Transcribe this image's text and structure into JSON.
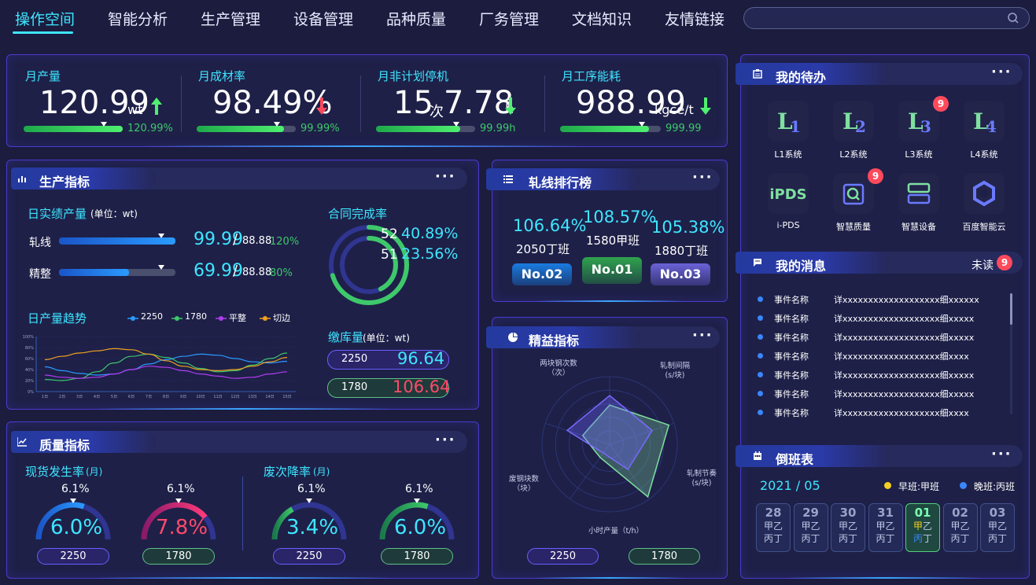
{
  "nav": {
    "items": [
      "操作空间",
      "智能分析",
      "生产管理",
      "设备管理",
      "品种质量",
      "厂务管理",
      "文档知识",
      "友情链接"
    ],
    "active_index": 0,
    "search_placeholder": ""
  },
  "kpis": [
    {
      "label": "月产量",
      "value": "120.99",
      "unit": "wt",
      "trend": "up",
      "percent": "120.99%",
      "progress": 1.0
    },
    {
      "label": "月成材率",
      "value": "98.49%",
      "unit": "",
      "trend": "down",
      "percent": "99.99%",
      "progress": 0.88
    },
    {
      "label": "月非计划停机",
      "value_a": "15",
      "unit_a": "次",
      "value_b": "7.78",
      "unit_b": "h",
      "trend": "down",
      "percent": "99.99h",
      "progress": 0.85
    },
    {
      "label": "月工序能耗",
      "value": "988.99",
      "unit": "kgce/t",
      "trend": "down",
      "percent": "999.99",
      "progress": 0.88
    }
  ],
  "production": {
    "title": "生产指标",
    "daily_title": "日实绩产量",
    "daily_unit": "(单位：wt)",
    "rows": [
      {
        "name": "轧线",
        "value": "99.99",
        "total": "88.88",
        "rate": "120%",
        "progress": 1.0
      },
      {
        "name": "精整",
        "value": "69.99",
        "total": "88.88",
        "rate": "80%",
        "progress": 0.6
      }
    ],
    "contract_title": "合同完成率",
    "contract": [
      {
        "num": "52",
        "pct": "40.89%",
        "value": 0.4089
      },
      {
        "num": "51",
        "pct": "23.56%",
        "value": 0.2356
      }
    ],
    "trend_title": "日产量趋势",
    "legend": [
      {
        "name": "2250",
        "color": "#2a9bff"
      },
      {
        "name": "1780",
        "color": "#3ec86a"
      },
      {
        "name": "平整",
        "color": "#b13cf0"
      },
      {
        "name": "切边",
        "color": "#f0a020"
      }
    ],
    "yticks": [
      "100%",
      "80%",
      "60%",
      "40%",
      "20%",
      "0%"
    ],
    "xticks": [
      "1日",
      "2日",
      "3日",
      "4日",
      "5日",
      "6日",
      "7日",
      "8日",
      "9日",
      "10日",
      "11日",
      "12日",
      "13日",
      "14日",
      "15日"
    ],
    "stock_title": "缴库量",
    "stock_unit": "(单位：wt)",
    "stock": [
      {
        "name": "2250",
        "value": "96.64"
      },
      {
        "name": "1780",
        "value": "106.64"
      }
    ]
  },
  "chart_data": {
    "type": "line",
    "x": [
      "1日",
      "2日",
      "3日",
      "4日",
      "5日",
      "6日",
      "7日",
      "8日",
      "9日",
      "10日",
      "11日",
      "12日",
      "13日",
      "14日",
      "15日"
    ],
    "ylim": [
      0,
      100
    ],
    "series": [
      {
        "name": "2250",
        "values": [
          45,
          38,
          33,
          30,
          32,
          40,
          50,
          58,
          64,
          68,
          66,
          60,
          54,
          52,
          55
        ]
      },
      {
        "name": "1780",
        "values": [
          22,
          20,
          24,
          36,
          52,
          64,
          68,
          62,
          52,
          42,
          36,
          38,
          48,
          60,
          70
        ]
      },
      {
        "name": "平整",
        "values": [
          30,
          26,
          24,
          26,
          32,
          40,
          46,
          44,
          38,
          32,
          28,
          24,
          26,
          32,
          36
        ]
      },
      {
        "name": "切边",
        "values": [
          58,
          64,
          70,
          74,
          78,
          76,
          68,
          56,
          46,
          40,
          38,
          40,
          46,
          54,
          62
        ]
      }
    ]
  },
  "ranking": {
    "title": "轧线排行榜",
    "items": [
      {
        "pct": "106.64%",
        "name": "2050丁班",
        "rank": "No.02",
        "color": "#1a7be0"
      },
      {
        "pct": "108.57%",
        "name": "1580甲班",
        "rank": "No.01",
        "color": "#2fa34e"
      },
      {
        "pct": "105.38%",
        "name": "1880丁班",
        "rank": "No.03",
        "color": "#6a62d8"
      }
    ]
  },
  "quality": {
    "title": "质量指标",
    "spot_title": "现货发生率",
    "spot_unit": "(月)",
    "scrap_title": "废次降率",
    "scrap_unit": "(月)",
    "gauges": [
      {
        "target": "6.1%",
        "value": "6.0%",
        "name": "2250",
        "color": "#2a9bff",
        "text": "#3ee6ff",
        "level": 0.6
      },
      {
        "target": "6.1%",
        "value": "7.8%",
        "name": "1780",
        "color": "#ff3a7a",
        "text": "#ff4a6a",
        "level": 0.78
      },
      {
        "target": "6.1%",
        "value": "3.4%",
        "name": "2250",
        "color": "#3ec86a",
        "text": "#3ee6ff",
        "level": 0.34
      },
      {
        "target": "6.1%",
        "value": "6.0%",
        "name": "1780",
        "color": "#3ec86a",
        "text": "#3ee6ff",
        "level": 0.6
      }
    ]
  },
  "lean": {
    "title": "精益指标",
    "axes": [
      "两块钢次数\n（次）",
      "轧制间隔\n(s/块)",
      "轧制节奏\n(s/块)",
      "小时产量（t/h）",
      "废钢块数\n（块）"
    ],
    "axis_lines": [
      [
        "两块钢次数",
        "（次）"
      ],
      [
        "轧制间隔",
        "(s/块)"
      ],
      [
        "轧制节奏",
        "(s/块)"
      ],
      [
        "小时产量（t/h）",
        ""
      ],
      [
        "废钢块数",
        "（块）"
      ]
    ],
    "series": [
      {
        "name": "2250",
        "values": [
          0.72,
          0.66,
          0.46,
          0.16,
          0.66
        ]
      },
      {
        "name": "1780",
        "values": [
          0.58,
          0.92,
          0.96,
          0.24,
          0.42
        ]
      }
    ],
    "buttons": [
      "2250",
      "1780"
    ]
  },
  "todo": {
    "title": "我的待办",
    "items": [
      {
        "label": "L1系统",
        "icon": "L1",
        "badge": ""
      },
      {
        "label": "L2系统",
        "icon": "L2",
        "badge": ""
      },
      {
        "label": "L3系统",
        "icon": "L3",
        "badge": "9"
      },
      {
        "label": "L4系统",
        "icon": "L4",
        "badge": ""
      },
      {
        "label": "i-PDS",
        "icon": "iPDS",
        "badge": ""
      },
      {
        "label": "智慧质量",
        "icon": "quality",
        "badge": "9"
      },
      {
        "label": "智慧设备",
        "icon": "device",
        "badge": ""
      },
      {
        "label": "百度智能云",
        "icon": "cloud",
        "badge": ""
      }
    ]
  },
  "messages": {
    "title": "我的消息",
    "unread_label": "未读",
    "unread_count": "9",
    "items": [
      {
        "name": "事件名称",
        "detail": "详xxxxxxxxxxxxxxxxxxx细xxxxxx"
      },
      {
        "name": "事件名称",
        "detail": "详xxxxxxxxxxxxxxxxxxx细xxxxx"
      },
      {
        "name": "事件名称",
        "detail": "详xxxxxxxxxxxxxxxxxxx细xxxxx"
      },
      {
        "name": "事件名称",
        "detail": "详xxxxxxxxxxxxxxxxxxx细xxxx"
      },
      {
        "name": "事件名称",
        "detail": "详xxxxxxxxxxxxxxxxxxx细xxxxx"
      },
      {
        "name": "事件名称",
        "detail": "详xxxxxxxxxxxxxxxxxxx细xxxxx"
      },
      {
        "name": "事件名称",
        "detail": "详xxxxxxxxxxxxxxxxxxx细xxxx"
      }
    ]
  },
  "shift": {
    "title": "倒班表",
    "month": "2021 / 05",
    "legend": [
      {
        "label": "早班:甲班",
        "color": "#f5d020"
      },
      {
        "label": "晚班:丙班",
        "color": "#3a86ff"
      }
    ],
    "days": [
      {
        "day": "28",
        "r1": "甲乙",
        "r2": "丙丁",
        "today": false
      },
      {
        "day": "29",
        "r1": "甲乙",
        "r2": "丙丁",
        "today": false
      },
      {
        "day": "30",
        "r1": "甲乙",
        "r2": "丙丁",
        "today": false
      },
      {
        "day": "31",
        "r1": "甲乙",
        "r2": "丙丁",
        "today": false
      },
      {
        "day": "01",
        "r1": "甲乙",
        "r2": "丙丁",
        "today": true
      },
      {
        "day": "02",
        "r1": "甲乙",
        "r2": "丙丁",
        "today": false
      },
      {
        "day": "03",
        "r1": "甲乙",
        "r2": "丙丁",
        "today": false
      }
    ]
  }
}
